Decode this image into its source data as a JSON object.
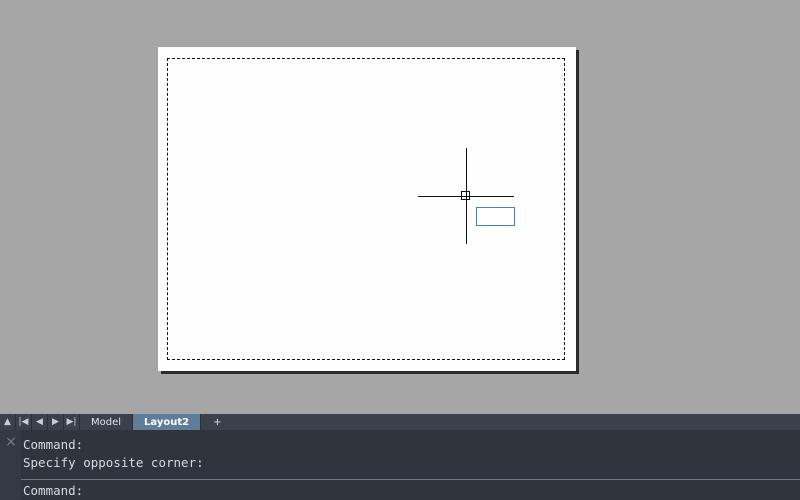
{
  "layout_tabs": {
    "nav": [
      "▲",
      "|◀",
      "◀",
      "▶",
      "▶|"
    ],
    "tabs": [
      {
        "label": "Model",
        "active": false
      },
      {
        "label": "Layout2",
        "active": true
      }
    ],
    "add_label": "+"
  },
  "command": {
    "close_label": "×",
    "history": [
      "Command:",
      "Specify opposite corner:"
    ],
    "prompt": "Command:"
  },
  "colors": {
    "viewport_bg": "#a6a6a6",
    "paper": "#fefefe",
    "tabbar_bg": "#3b414a",
    "active_tab": "#5f7c99",
    "command_bg": "#2f353d",
    "dynamic_input_border": "#3f7fd9"
  }
}
